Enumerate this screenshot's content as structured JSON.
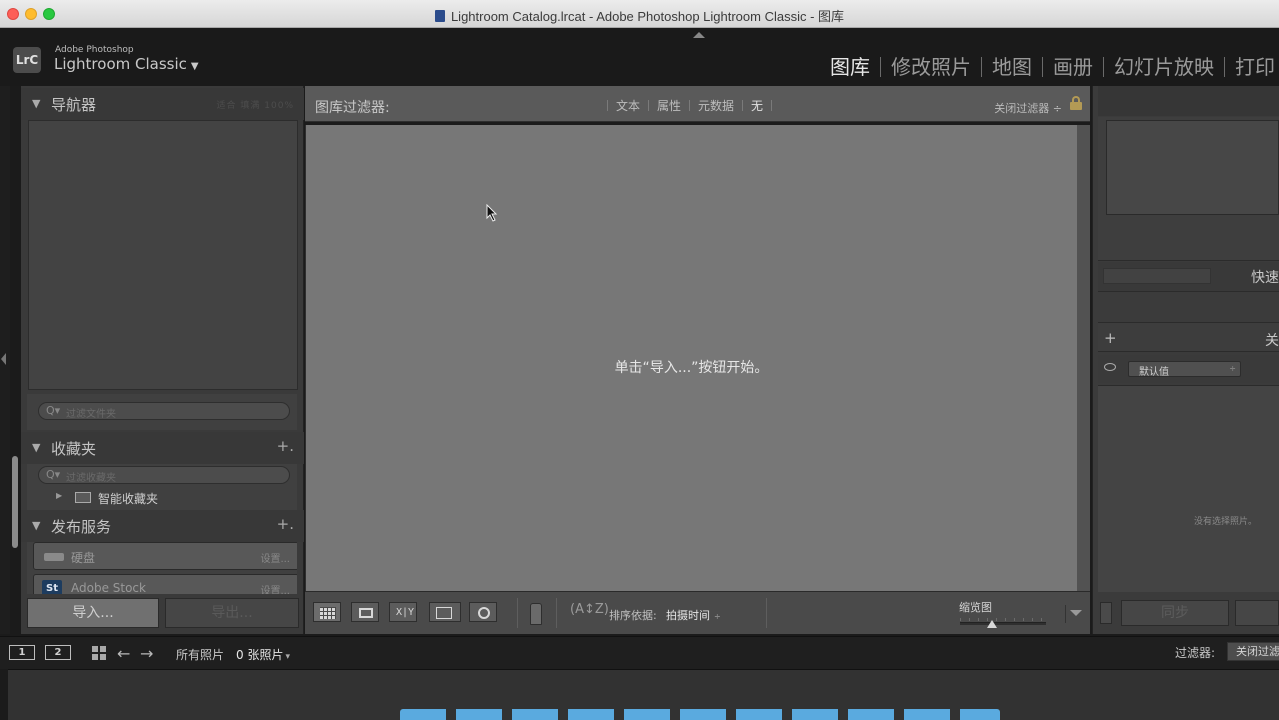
{
  "window": {
    "title": "Lightroom Catalog.lrcat - Adobe Photoshop Lightroom Classic - 图库"
  },
  "identity": {
    "badge": "LrC",
    "vendor": "Adobe Photoshop",
    "product": "Lightroom Classic",
    "caret": "▼"
  },
  "modules": [
    {
      "label": "图库",
      "active": true
    },
    {
      "label": "修改照片",
      "active": false
    },
    {
      "label": "地图",
      "active": false
    },
    {
      "label": "画册",
      "active": false
    },
    {
      "label": "幻灯片放映",
      "active": false
    },
    {
      "label": "打印",
      "active": false
    }
  ],
  "left_panel": {
    "navigator": {
      "title": "导航器",
      "zoom_options_faint": "适合 填满 100%"
    },
    "folder_search_placeholder": "过滤文件夹",
    "collections": {
      "title": "收藏夹",
      "plus": "+.",
      "search_placeholder": "过滤收藏夹",
      "smart_collections": "智能收藏夹"
    },
    "publish": {
      "title": "发布服务",
      "plus": "+.",
      "services": [
        {
          "label": "硬盘",
          "settings": "设置..."
        },
        {
          "label": "Adobe Stock",
          "settings": "设置..."
        }
      ]
    },
    "import_label": "导入...",
    "export_label": "导出..."
  },
  "filter_bar": {
    "title": "图库过滤器:",
    "options": [
      "文本",
      "属性",
      "元数据"
    ],
    "none_label": "无",
    "close_label": "关闭过滤器 ÷"
  },
  "grid": {
    "empty_message": "单击“导入...”按钮开始。"
  },
  "toolbar": {
    "xy_label": "X|Y",
    "sort_az": "(A↕Z)",
    "sort_label": "排序依据:",
    "sort_value": "拍摄时间",
    "thumbnail_label": "缩览图",
    "updown": "÷"
  },
  "right_panel": {
    "quick_develop_title": "快速",
    "keywording_title": "关",
    "metadata_preset": "默认值",
    "metadata_empty": "没有选择照片。",
    "sync_label": "同步"
  },
  "filmstrip_bar": {
    "screen1": "1",
    "screen2": "2",
    "source": "所有照片",
    "count": "0 张照片",
    "count_caret": "▾",
    "filter_label": "过滤器:",
    "filter_value": "关闭过滤器"
  },
  "colors": {
    "accent_active": "#e6e6e6",
    "grid_background": "#777777",
    "caption_blue": "#5fb7f2"
  }
}
